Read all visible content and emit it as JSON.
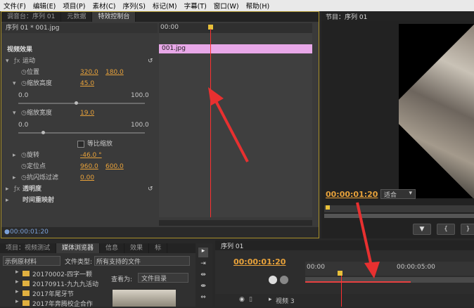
{
  "menubar": [
    "文件(F)",
    "编辑(E)",
    "项目(P)",
    "素材(C)",
    "序列(S)",
    "标记(M)",
    "字幕(T)",
    "窗口(W)",
    "帮助(H)"
  ],
  "fx": {
    "tabs": [
      "调音台：序列 01",
      "元数据",
      "特效控制台"
    ],
    "sequence_label": "序列 01 * 001.jpg",
    "ruler_start": "00:00",
    "clip_name": "001.jpg",
    "header": "视频效果",
    "motion": "运动",
    "position_label": "位置",
    "position_x": "320.0",
    "position_y": "180.0",
    "scale_height_label": "缩放高度",
    "scale_height": "45.0",
    "slider_min": "0.0",
    "slider_max": "100.0",
    "scale_width_label": "缩放宽度",
    "scale_width": "19.0",
    "uniform_scale": "等比缩放",
    "rotation_label": "旋转",
    "rotation": "-46.0 °",
    "anchor_label": "定位点",
    "anchor_x": "960.0",
    "anchor_y": "600.0",
    "antiflicker_label": "抗闪烁过滤",
    "antiflicker": "0.00",
    "opacity": "透明度",
    "time_remap": "时间重映射",
    "timecode": "00:00:01:20"
  },
  "program": {
    "tab": "节目：序列 01",
    "timecode": "00:00:01:20",
    "fit": "适合"
  },
  "project": {
    "tabs": [
      "项目：视频测试",
      "媒体浏览器",
      "信息",
      "效果",
      "标"
    ],
    "source_dropdown": "示例原材料",
    "file_type_label": "文件类型:",
    "file_type_value": "所有支持的文件",
    "view_as_label": "查看为:",
    "view_as_value": "文件目录",
    "folders": [
      "20170002-四字一颗",
      "20170911-九九九活动",
      "2017年尾牙节",
      "2017年奔腾校企合作"
    ]
  },
  "timeline": {
    "tab": "序列 01",
    "timecode": "00:00:01:20",
    "ruler_start": "00:00",
    "ruler_mark": "00:00:05:00",
    "track": "视频 3"
  }
}
